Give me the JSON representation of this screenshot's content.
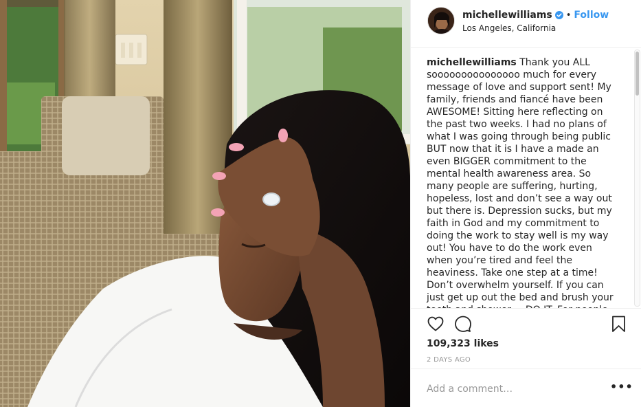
{
  "post": {
    "username": "michellewilliams",
    "follow_label": "Follow",
    "separator": "•",
    "location": "Los Angeles, California",
    "caption_user": "michellewilliams",
    "caption_text": " Thank you ALL sooooooooooooooo much for every message of love and support sent! My family, friends and fiancé have been AWESOME! Sitting here reflecting on the past two weeks. I had no plans of what I was going through being public BUT now that it is I have a made an even BIGGER commitment to the mental health awareness area. So many people are suffering, hurting, hopeless, lost and don’t see a way out but there is. Depression sucks, but my faith in God and my commitment to doing the work to stay well is my way out! You have to do the work even when you’re tired and feel the heaviness. Take one step at a time! Don’t overwhelm yourself. If you can just get up out the bed and brush your teeth and shower.....DO IT. For people dealing with depression that is",
    "likes": "109,323 likes",
    "timestamp": "2 DAYS AGO"
  },
  "comment": {
    "placeholder": "Add a comment…",
    "more_label": "•••"
  },
  "colors": {
    "accent": "#3897f0",
    "text": "#262626",
    "muted": "#999999",
    "border": "#efefef"
  },
  "icons": {
    "verified": "verified-badge-icon",
    "like": "heart-icon",
    "comment": "comment-bubble-icon",
    "save": "bookmark-icon",
    "options": "more-options-icon"
  }
}
